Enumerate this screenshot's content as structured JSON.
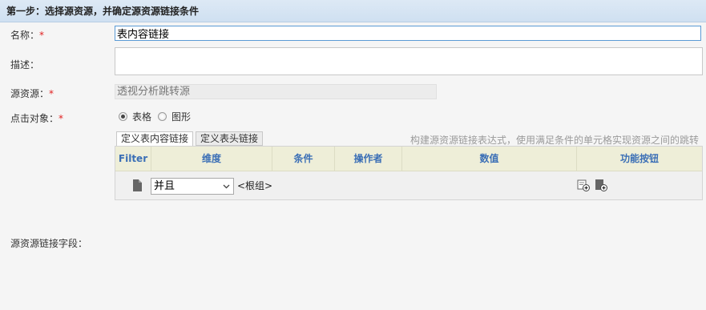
{
  "step": {
    "title": "第一步：选择源资源，并确定源资源链接条件"
  },
  "form": {
    "name_label": "名称：",
    "required_mark": "*",
    "name_value": "表内容链接",
    "desc_label": "描述：",
    "desc_value": "",
    "source_label": "源资源：",
    "source_value": "透视分析跳转源",
    "click_target_label": "点击对象：",
    "click_options": [
      {
        "label": "表格",
        "selected": true
      },
      {
        "label": "图形",
        "selected": false
      }
    ]
  },
  "tabs": [
    {
      "label": "定义表内容链接",
      "active": true
    },
    {
      "label": "定义表头链接",
      "active": false
    }
  ],
  "hint": "构建源资源链接表达式，使用满足条件的单元格实现资源之间的跳转",
  "table": {
    "columns": [
      "Filter",
      "维度",
      "条件",
      "操作者",
      "数值",
      "功能按钮"
    ],
    "row": {
      "logic_select": "并且",
      "group_label": "<根组>"
    }
  },
  "bottom": {
    "link_fields_label": "源资源链接字段："
  },
  "colors": {
    "header_bg": "#dde9f5",
    "table_header_bg": "#eeeed8",
    "column_text": "#3b6fb6",
    "required": "#e02020"
  },
  "icons": [
    "document-icon",
    "chevron-down-icon",
    "add-condition-icon",
    "add-group-icon"
  ]
}
